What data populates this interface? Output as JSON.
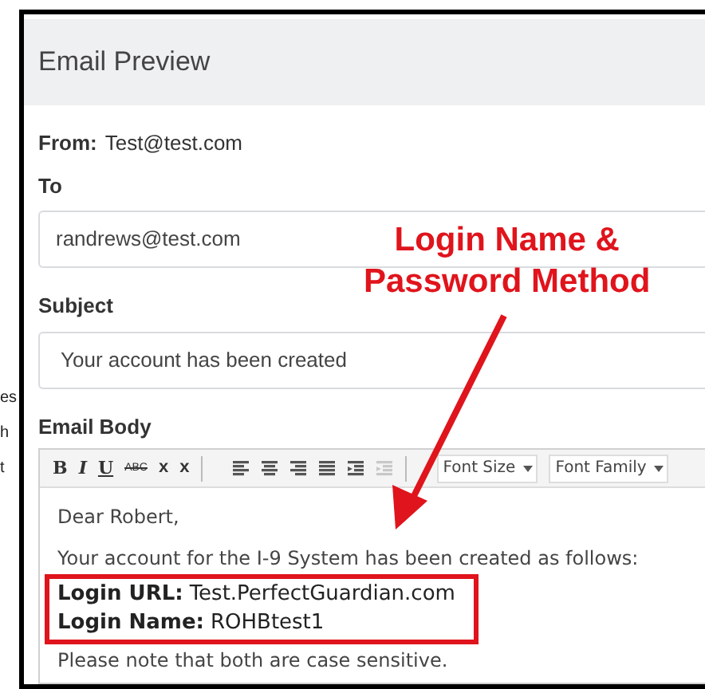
{
  "background": {
    "fragments": [
      "es",
      "h",
      "t"
    ]
  },
  "modal": {
    "title": "Email Preview",
    "from": {
      "label": "From:",
      "value": "Test@test.com"
    },
    "to": {
      "label": "To",
      "value": "randrews@test.com"
    },
    "subject": {
      "label": "Subject",
      "value": "Your account has been created"
    },
    "body": {
      "label": "Email Body",
      "toolbar": [
        {
          "kind": "bold",
          "label": "B",
          "disabled": false
        },
        {
          "kind": "italic",
          "label": "I",
          "disabled": false
        },
        {
          "kind": "underline",
          "label": "U",
          "disabled": false
        },
        {
          "kind": "strike",
          "label": "ABC",
          "disabled": false
        },
        {
          "kind": "subscript",
          "label": "x",
          "disabled": false
        },
        {
          "kind": "superscript",
          "label": "x",
          "disabled": false
        },
        {
          "kind": "separator"
        },
        {
          "kind": "alignleft",
          "disabled": false
        },
        {
          "kind": "aligncenter",
          "disabled": false
        },
        {
          "kind": "alignright",
          "disabled": false
        },
        {
          "kind": "justify",
          "disabled": false
        },
        {
          "kind": "outdent",
          "disabled": false
        },
        {
          "kind": "indent",
          "disabled": true
        },
        {
          "kind": "separator"
        },
        {
          "kind": "dropdown",
          "label": "Font Size",
          "disabled": false
        },
        {
          "kind": "dropdown",
          "label": "Font Family",
          "disabled": false
        }
      ],
      "paragraphs": [
        {
          "kind": "text",
          "text": "Dear Robert,"
        },
        {
          "kind": "text",
          "text": "Your account for the I-9 System has been created as follows:"
        },
        {
          "kind": "credentials",
          "lines": [
            {
              "label": "Login URL:",
              "value": "Test.PerfectGuardian.com"
            },
            {
              "label": "Login Name:",
              "value": "ROHBtest1"
            }
          ]
        },
        {
          "kind": "text",
          "text": "Please note that both are case sensitive."
        }
      ]
    }
  },
  "annotation": {
    "lines": [
      "Login Name &",
      "Password Method"
    ]
  }
}
